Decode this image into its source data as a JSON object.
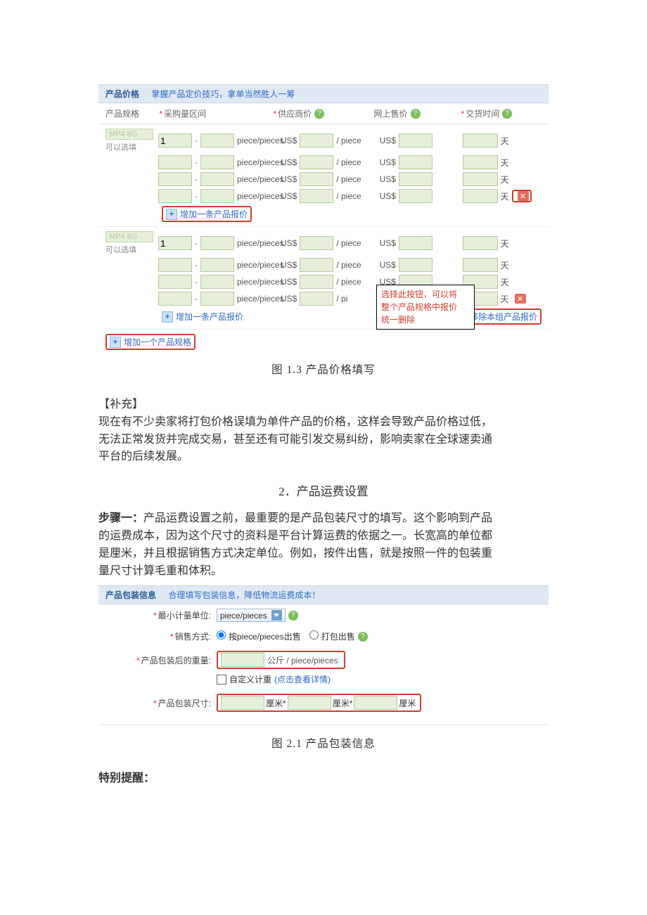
{
  "pricePanel": {
    "title": "产品价格",
    "tipLink": "掌握产品定价技巧，拿单当然胜人一筹",
    "columns": {
      "prodSpec": "产品规格",
      "qtyRange": "采购量区间",
      "supplierPrice": "供应商价",
      "webPrice": "网上售价",
      "deliveryTime": "交货时间"
    },
    "specPlaceholder": "MP4 8G",
    "specHint": "可以选填",
    "unitPiece": "piece/pieces",
    "currency": "US$",
    "perPiece": "/ piece",
    "dayUnit": "天",
    "qtyStart": "1",
    "addRowLabel": "增加一条产品报价",
    "addSpecLabel": "增加一个产品规格",
    "removeGroupLabel": "移除本组产品报价",
    "callout": {
      "l1": "选择此按钮，可以将",
      "l2": "整个产品规格中报价",
      "l3": "统一删除"
    }
  },
  "captions": {
    "fig13": "图 1.3 产品价格填写",
    "fig21": "图 2.1 产品包装信息"
  },
  "text": {
    "suppHead": "【补充】",
    "supp1": "现在有不少卖家将打包价格误填为单件产品的价格，这样会导致产品价格过低，",
    "supp2": "无法正常发货并完成交易，甚至还有可能引发交易纠纷，影响卖家在全球速卖通",
    "supp3": "平台的后续发展。",
    "sect2": "2．产品运费设置",
    "step1Head": "步骤一：",
    "step1a": "产品运费设置之前，最重要的是产品包装尺寸的填写。这个影响到产品",
    "step1b": "的运费成本，因为这个尺寸的资料是平台计算运费的依据之一。长宽高的单位都",
    "step1c": "是厘米，并且根据销售方式决定单位。例如，按件出售，就是按照一件的包装重",
    "step1d": "量尺寸计算毛重和体积。",
    "remindHead": "特别提醒："
  },
  "pkgPanel": {
    "title": "产品包装信息",
    "tipLink": "合理填写包装信息，降低物流运费成本！",
    "rows": {
      "unitLabel": "最小计量单位:",
      "unitValue": "piece/pieces",
      "saleModeLabel": "销售方式:",
      "saleByPiece": "按piece/pieces出售",
      "saleByPack": "打包出售",
      "weightLabel": "产品包装后的重量:",
      "weightUnit": "公斤 / piece/pieces",
      "customWeight": "自定义计重",
      "customDetail": "(点击查看详情)",
      "sizeLabel": "产品包装尺寸:",
      "cm": "厘米"
    }
  }
}
